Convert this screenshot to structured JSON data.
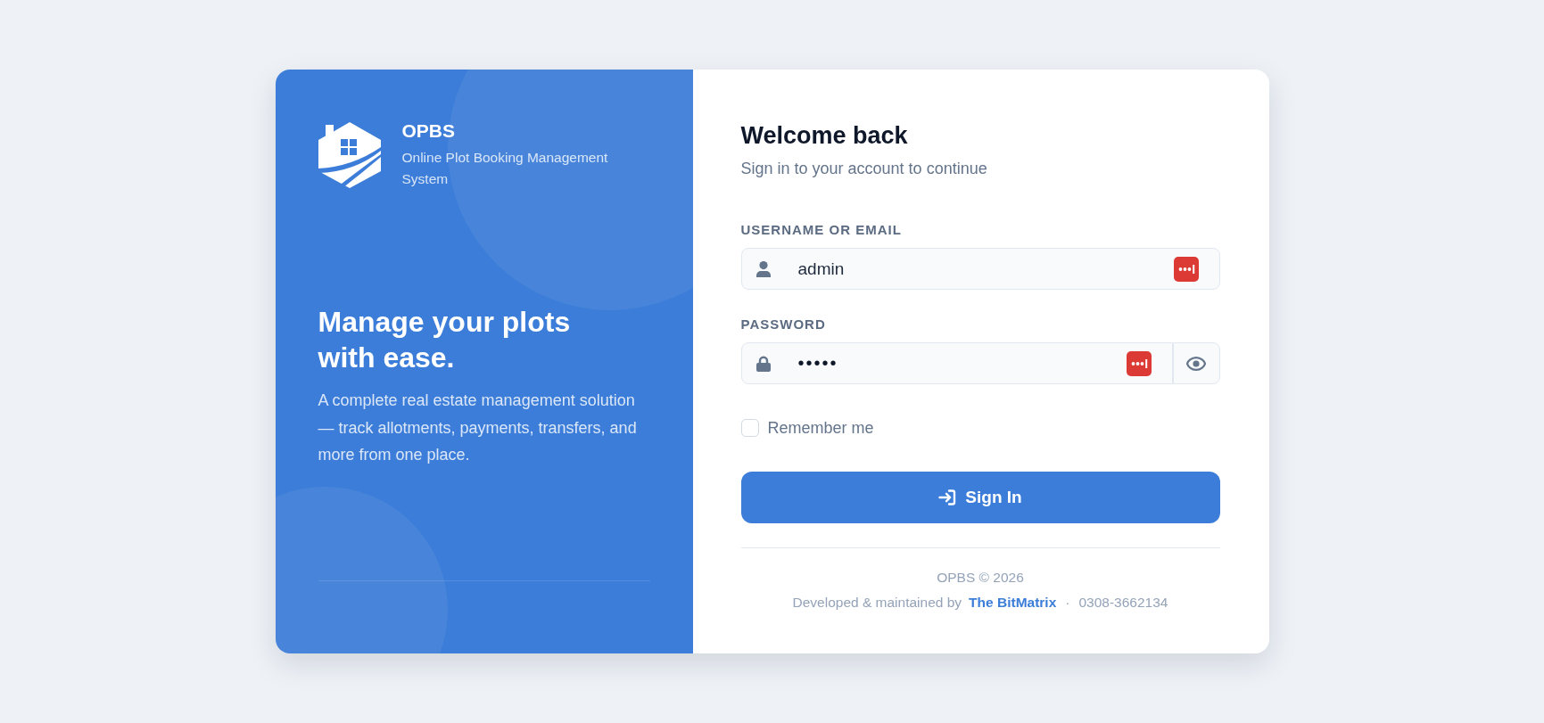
{
  "brand": {
    "name": "OPBS",
    "tagline": "Online Plot Booking Management System"
  },
  "hero": {
    "heading": "Manage your plots with ease.",
    "description": "A complete real estate management solution — track allotments, payments, transfers, and more from one place."
  },
  "form": {
    "title": "Welcome back",
    "subtitle": "Sign in to your account to continue",
    "fields": [
      {
        "kind": "text",
        "label": "USERNAME OR EMAIL",
        "value": "admin"
      },
      {
        "kind": "password",
        "label": "PASSWORD",
        "value": "•••••"
      }
    ],
    "remember": {
      "label": "Remember me",
      "checked": false
    },
    "submit": {
      "label": "Sign In"
    }
  },
  "footer": {
    "copyright": "OPBS © 2026",
    "credit": "Developed & maintained by",
    "link": "The BitMatrix",
    "separator": "·",
    "phone": "0308-3662134"
  }
}
